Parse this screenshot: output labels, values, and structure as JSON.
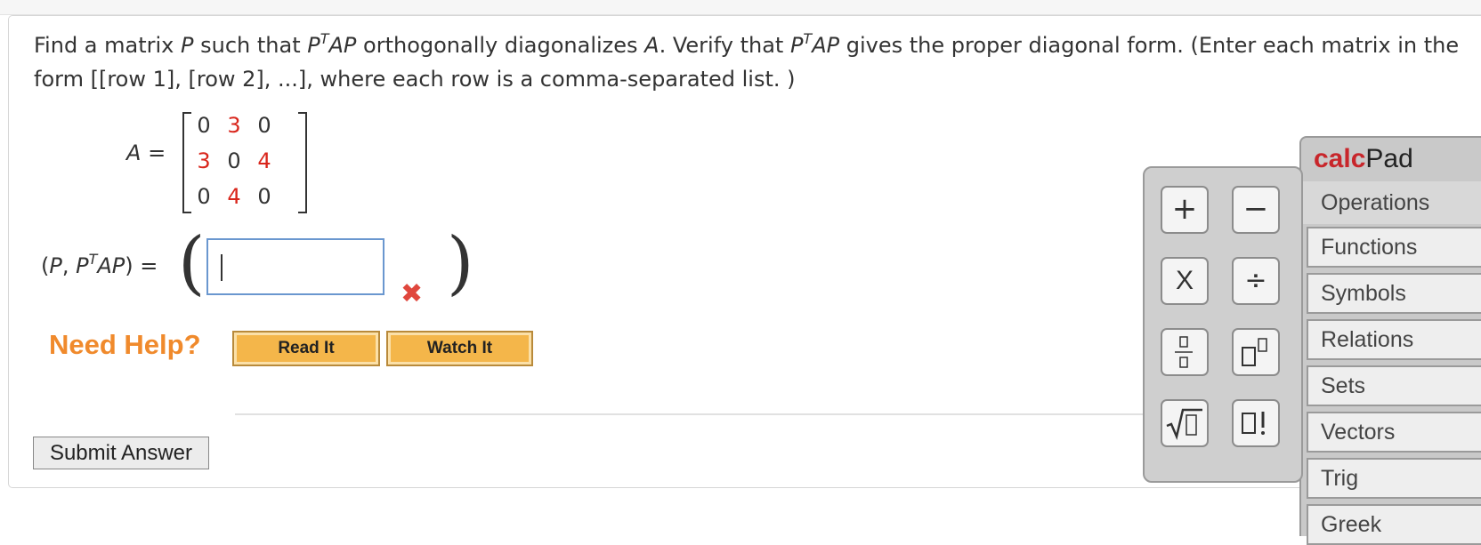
{
  "question": {
    "p1": "Find a matrix ",
    "P": "P",
    "p2": " such that ",
    "PTAP1": "P",
    "T1": "T",
    "AP1": "AP",
    "p3": " orthogonally diagonalizes ",
    "A1": "A",
    "p4": ". Verify that ",
    "PTAP2": "P",
    "T2": "T",
    "AP2": "AP",
    "p5": " gives the proper diagonal form. (Enter each matrix in the form [[row 1], [row 2], ...], where each row is a comma-separated list. )"
  },
  "matrix_A": {
    "label": "A",
    "equals": "=",
    "rows": [
      [
        "0",
        "3",
        "0"
      ],
      [
        "3",
        "0",
        "4"
      ],
      [
        "0",
        "4",
        "0"
      ]
    ],
    "highlight_color": "#d9261c"
  },
  "answer": {
    "label_open": "(",
    "label_P": "P",
    "label_sep": ", ",
    "label_P2": "P",
    "label_T": "T",
    "label_AP": "AP",
    "label_close": ")",
    "equals": "=",
    "value": "",
    "status": "incorrect"
  },
  "help": {
    "title": "Need Help?",
    "read_it": "Read It",
    "watch_it": "Watch It"
  },
  "submit": "Submit Answer",
  "calcpad": {
    "title_bold": "calc",
    "title_rest": "Pad",
    "keys": {
      "plus": "+",
      "minus": "−",
      "times": "X",
      "divide": "÷"
    },
    "tabs": [
      "Operations",
      "Functions",
      "Symbols",
      "Relations",
      "Sets",
      "Vectors",
      "Trig",
      "Greek"
    ],
    "active_tab": "Operations"
  }
}
